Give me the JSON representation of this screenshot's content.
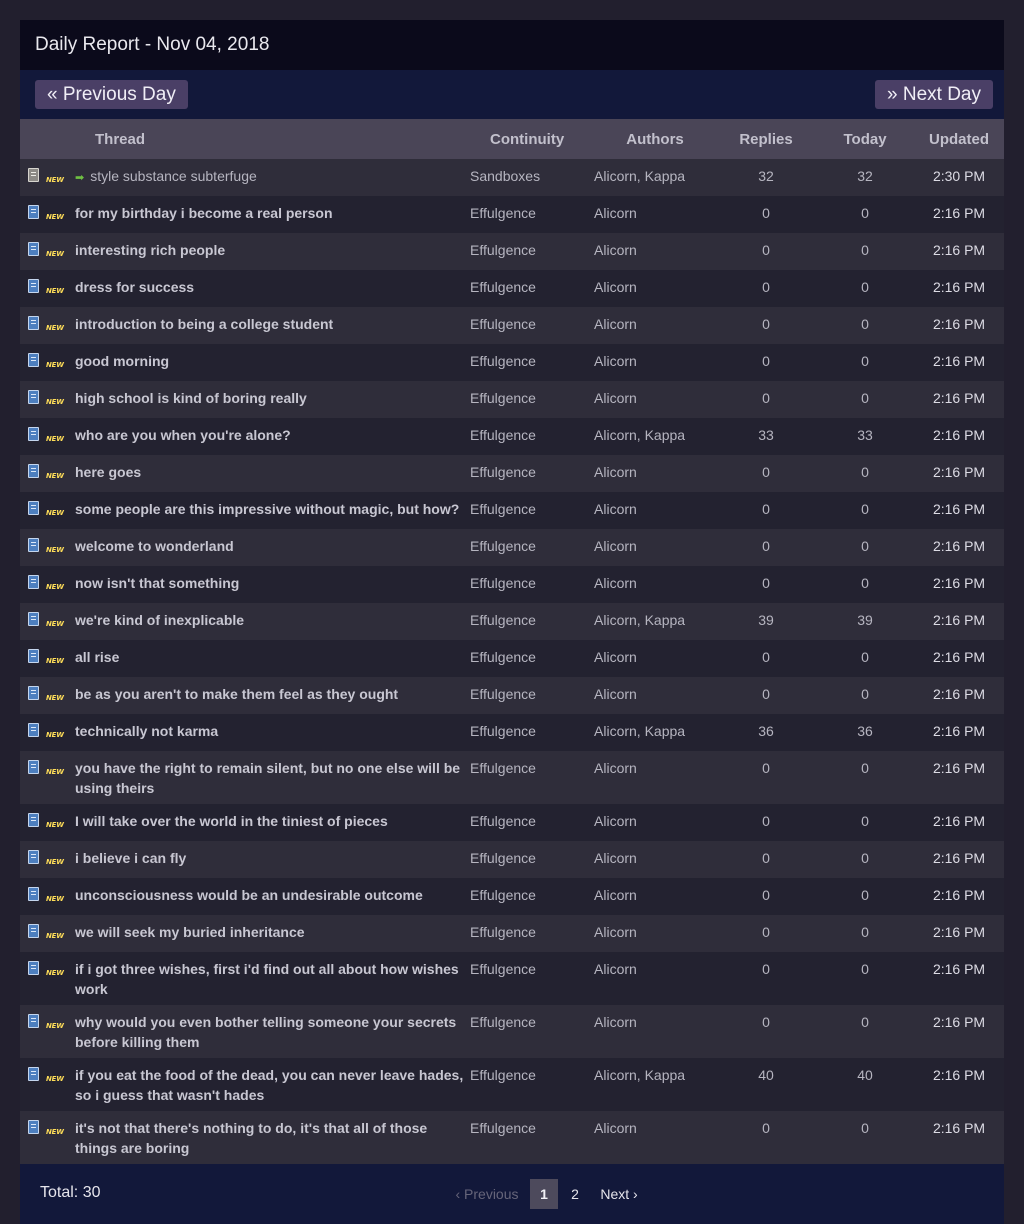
{
  "header": {
    "title": "Daily Report - Nov 04, 2018"
  },
  "nav": {
    "prev_label": "« Previous Day",
    "next_label": "» Next Day"
  },
  "columns": {
    "thread": "Thread",
    "continuity": "Continuity",
    "authors": "Authors",
    "replies": "Replies",
    "today": "Today",
    "updated": "Updated"
  },
  "badge_text": "NEW",
  "rows": [
    {
      "title": "style substance subterfuge",
      "continuity": "Sandboxes",
      "authors": "Alicorn, Kappa",
      "replies": "32",
      "today": "32",
      "updated": "2:30 PM"
    },
    {
      "title": "for my birthday i become a real person",
      "continuity": "Effulgence",
      "authors": "Alicorn",
      "replies": "0",
      "today": "0",
      "updated": "2:16 PM"
    },
    {
      "title": "interesting rich people",
      "continuity": "Effulgence",
      "authors": "Alicorn",
      "replies": "0",
      "today": "0",
      "updated": "2:16 PM"
    },
    {
      "title": "dress for success",
      "continuity": "Effulgence",
      "authors": "Alicorn",
      "replies": "0",
      "today": "0",
      "updated": "2:16 PM"
    },
    {
      "title": "introduction to being a college student",
      "continuity": "Effulgence",
      "authors": "Alicorn",
      "replies": "0",
      "today": "0",
      "updated": "2:16 PM"
    },
    {
      "title": "good morning",
      "continuity": "Effulgence",
      "authors": "Alicorn",
      "replies": "0",
      "today": "0",
      "updated": "2:16 PM"
    },
    {
      "title": "high school is kind of boring really",
      "continuity": "Effulgence",
      "authors": "Alicorn",
      "replies": "0",
      "today": "0",
      "updated": "2:16 PM"
    },
    {
      "title": "who are you when you're alone?",
      "continuity": "Effulgence",
      "authors": "Alicorn, Kappa",
      "replies": "33",
      "today": "33",
      "updated": "2:16 PM"
    },
    {
      "title": "here goes",
      "continuity": "Effulgence",
      "authors": "Alicorn",
      "replies": "0",
      "today": "0",
      "updated": "2:16 PM"
    },
    {
      "title": "some people are this impressive without magic, but how?",
      "continuity": "Effulgence",
      "authors": "Alicorn",
      "replies": "0",
      "today": "0",
      "updated": "2:16 PM"
    },
    {
      "title": "welcome to wonderland",
      "continuity": "Effulgence",
      "authors": "Alicorn",
      "replies": "0",
      "today": "0",
      "updated": "2:16 PM"
    },
    {
      "title": "now isn't that something",
      "continuity": "Effulgence",
      "authors": "Alicorn",
      "replies": "0",
      "today": "0",
      "updated": "2:16 PM"
    },
    {
      "title": "we're kind of inexplicable",
      "continuity": "Effulgence",
      "authors": "Alicorn, Kappa",
      "replies": "39",
      "today": "39",
      "updated": "2:16 PM"
    },
    {
      "title": "all rise",
      "continuity": "Effulgence",
      "authors": "Alicorn",
      "replies": "0",
      "today": "0",
      "updated": "2:16 PM"
    },
    {
      "title": "be as you aren't to make them feel as they ought",
      "continuity": "Effulgence",
      "authors": "Alicorn",
      "replies": "0",
      "today": "0",
      "updated": "2:16 PM"
    },
    {
      "title": "technically not karma",
      "continuity": "Effulgence",
      "authors": "Alicorn, Kappa",
      "replies": "36",
      "today": "36",
      "updated": "2:16 PM"
    },
    {
      "title": "you have the right to remain silent, but no one else will be using theirs",
      "continuity": "Effulgence",
      "authors": "Alicorn",
      "replies": "0",
      "today": "0",
      "updated": "2:16 PM"
    },
    {
      "title": "I will take over the world in the tiniest of pieces",
      "continuity": "Effulgence",
      "authors": "Alicorn",
      "replies": "0",
      "today": "0",
      "updated": "2:16 PM"
    },
    {
      "title": "i believe i can fly",
      "continuity": "Effulgence",
      "authors": "Alicorn",
      "replies": "0",
      "today": "0",
      "updated": "2:16 PM"
    },
    {
      "title": "unconsciousness would be an undesirable outcome",
      "continuity": "Effulgence",
      "authors": "Alicorn",
      "replies": "0",
      "today": "0",
      "updated": "2:16 PM"
    },
    {
      "title": "we will seek my buried inheritance",
      "continuity": "Effulgence",
      "authors": "Alicorn",
      "replies": "0",
      "today": "0",
      "updated": "2:16 PM"
    },
    {
      "title": "if i got three wishes, first i'd find out all about how wishes work",
      "continuity": "Effulgence",
      "authors": "Alicorn",
      "replies": "0",
      "today": "0",
      "updated": "2:16 PM"
    },
    {
      "title": "why would you even bother telling someone your secrets before killing them",
      "continuity": "Effulgence",
      "authors": "Alicorn",
      "replies": "0",
      "today": "0",
      "updated": "2:16 PM"
    },
    {
      "title": "if you eat the food of the dead, you can never leave hades, so i guess that wasn't hades",
      "continuity": "Effulgence",
      "authors": "Alicorn, Kappa",
      "replies": "40",
      "today": "40",
      "updated": "2:16 PM"
    },
    {
      "title": "it's not that there's nothing to do, it's that all of those things are boring",
      "continuity": "Effulgence",
      "authors": "Alicorn",
      "replies": "0",
      "today": "0",
      "updated": "2:16 PM"
    }
  ],
  "footer": {
    "total": "Total: 30",
    "pager": {
      "prev": "‹ Previous",
      "current": "1",
      "page2": "2",
      "next": "Next ›"
    }
  }
}
